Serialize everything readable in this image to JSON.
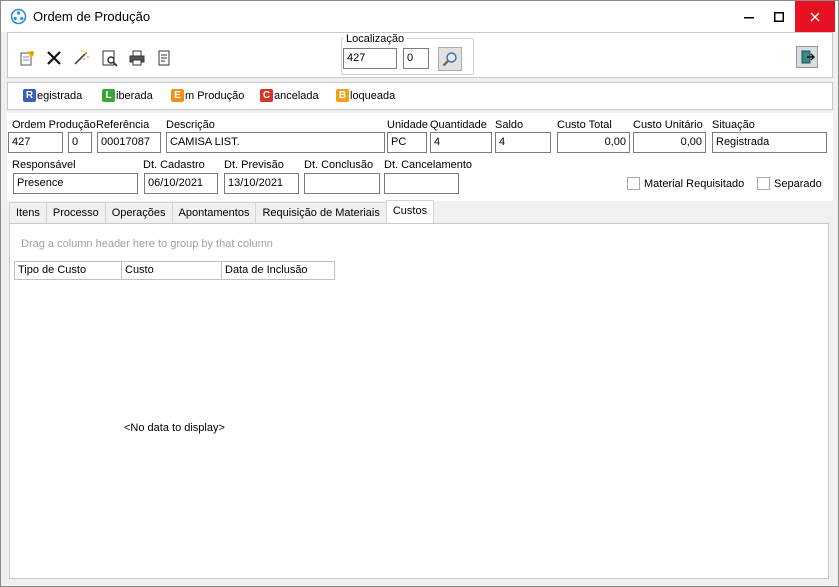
{
  "window": {
    "title": "Ordem de Produção"
  },
  "toolbar": {
    "localizacao_label": "Localização",
    "localizacao_value": "427",
    "localizacao_seq": "0"
  },
  "status_legend": [
    {
      "letter": "R",
      "rest": "egistrada",
      "color": "#3a5fb8"
    },
    {
      "letter": "L",
      "rest": "iberada",
      "color": "#3aa635"
    },
    {
      "letter": "E",
      "rest": "m Produção",
      "color": "#f0901e"
    },
    {
      "letter": "C",
      "rest": "ancelada",
      "color": "#d93226"
    },
    {
      "letter": "B",
      "rest": "loqueada",
      "color": "#e8a317"
    }
  ],
  "form": {
    "ordem_producao_label": "Ordem Produção",
    "ordem_producao": "427",
    "ordem_seq": "0",
    "referencia_label": "Referência",
    "referencia": "00017087",
    "descricao_label": "Descrição",
    "descricao": "CAMISA LIST.",
    "unidade_label": "Unidade",
    "unidade": "PC",
    "quantidade_label": "Quantidade",
    "quantidade": "4",
    "saldo_label": "Saldo",
    "saldo": "4",
    "custo_total_label": "Custo Total",
    "custo_total": "0,00",
    "custo_unitario_label": "Custo Unitário",
    "custo_unitario": "0,00",
    "situacao_label": "Situação",
    "situacao": "Registrada",
    "responsavel_label": "Responsável",
    "responsavel": "Presence",
    "dt_cadastro_label": "Dt. Cadastro",
    "dt_cadastro": "06/10/2021",
    "dt_previsao_label": "Dt. Previsão",
    "dt_previsao": "13/10/2021",
    "dt_conclusao_label": "Dt. Conclusão",
    "dt_conclusao": "",
    "dt_cancelamento_label": "Dt. Cancelamento",
    "dt_cancelamento": "",
    "material_requisitado_label": "Material Requisitado",
    "separado_label": "Separado"
  },
  "tabs": [
    "Itens",
    "Processo",
    "Operações",
    "Apontamentos",
    "Requisição de Materiais",
    "Custos"
  ],
  "active_tab": "Custos",
  "grid": {
    "group_hint": "Drag a column header here to group by that column",
    "columns": [
      "Tipo de Custo",
      "Custo",
      "Data de Inclusão"
    ],
    "empty_text": "<No data to display>"
  }
}
